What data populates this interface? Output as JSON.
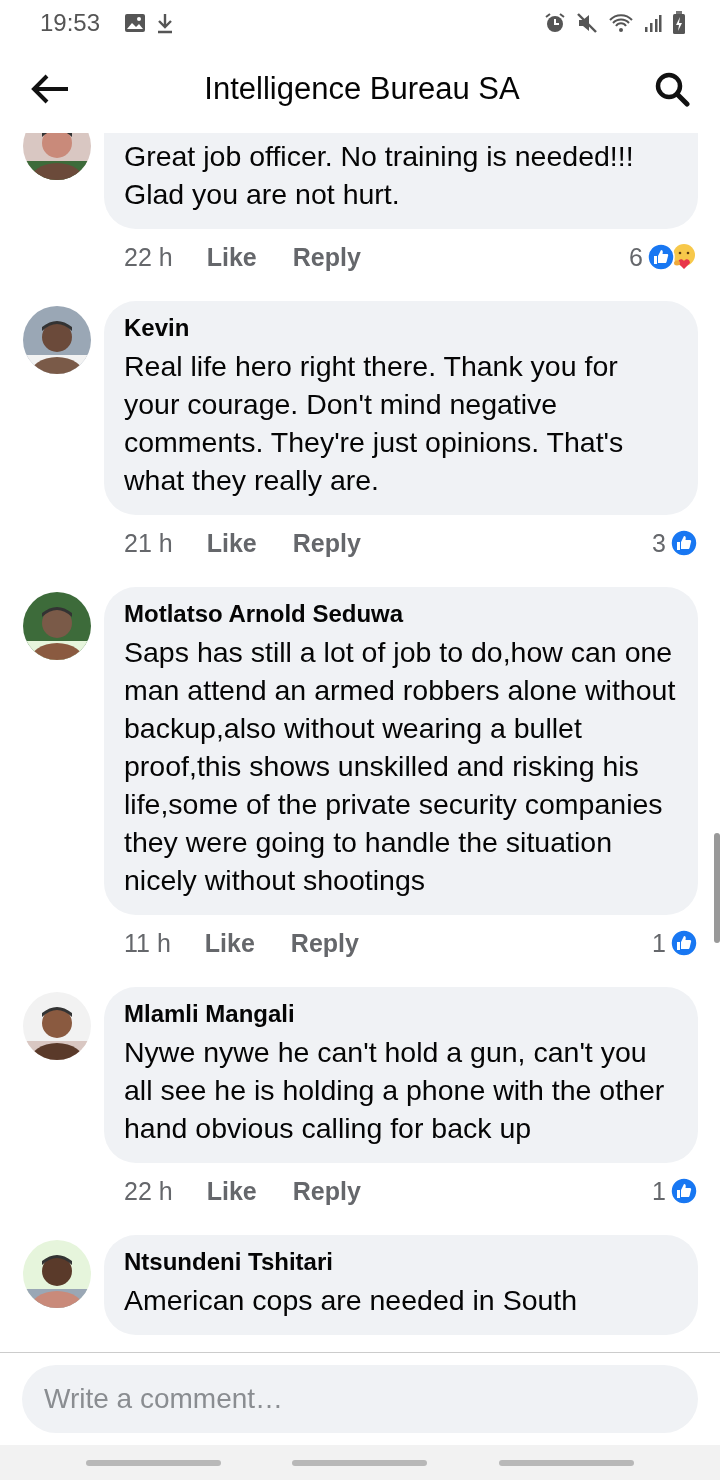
{
  "status_bar": {
    "time": "19:53"
  },
  "header": {
    "title": "Intelligence Bureau SA"
  },
  "comments": [
    {
      "text": "Great job officer. No training is needed!!! Glad you are not hurt.",
      "time": "22 h",
      "like": "Like",
      "reply": "Reply",
      "count": "6",
      "reactions": [
        {
          "kind": "like"
        },
        {
          "kind": "care"
        }
      ]
    },
    {
      "name": "Kevin",
      "text": "Real life hero right there. Thank you for your courage. Don't mind negative comments. They're just opinions. That's what they really are.",
      "time": "21 h",
      "like": "Like",
      "reply": "Reply",
      "count": "3",
      "reactions": [
        {
          "kind": "like"
        }
      ]
    },
    {
      "name": "Motlatso Arnold Seduwa",
      "text": "Saps has still a lot of job to do,how can one man attend an armed robbers alone without backup,also without wearing a bullet proof,this shows unskilled and risking his life,some of the private security companies they were going to handle the situation nicely without shootings",
      "time": "11 h",
      "like": "Like",
      "reply": "Reply",
      "count": "1",
      "reactions": [
        {
          "kind": "like"
        }
      ]
    },
    {
      "name": "Mlamli Mangali",
      "text": "Nywe nywe he can't hold a gun, can't you all see he is holding a phone with the other hand  obvious calling for back up",
      "time": "22 h",
      "like": "Like",
      "reply": "Reply",
      "count": "1",
      "reactions": [
        {
          "kind": "like"
        }
      ]
    },
    {
      "name": "Ntsundeni Tshitari",
      "text": "American cops are needed in South"
    }
  ],
  "composer": {
    "placeholder": "Write a comment…"
  }
}
